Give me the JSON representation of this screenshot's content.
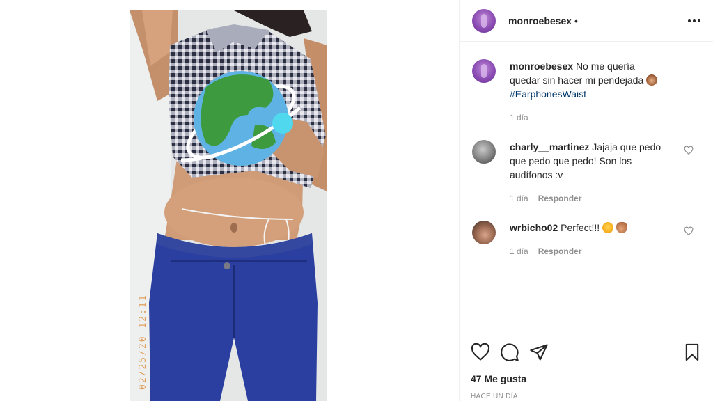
{
  "post": {
    "username": "monroebesex",
    "separator": "•",
    "photo_date_stamp": "02/25/20 12:11"
  },
  "caption": {
    "username": "monroebesex",
    "text": "No me quería quedar sin hacer mi pendejada",
    "emoji": "see-no-evil-monkey",
    "hashtag": "#EarphonesWaist",
    "time": "1 día"
  },
  "comments": [
    {
      "username": "charly__martinez",
      "text": "Jajaja que pedo que pedo que pedo! Son los audífonos :v",
      "time": "1 día",
      "reply_label": "Responder"
    },
    {
      "username": "wrbicho02",
      "text": "Perfect!!!",
      "emoji": [
        "star-struck-face",
        "ok-hand"
      ],
      "time": "1 día",
      "reply_label": "Responder"
    }
  ],
  "actions": {
    "likes": "47 Me gusta",
    "posted": "HACE UN DÍA",
    "icons": [
      "heart-icon",
      "comment-icon",
      "share-icon",
      "bookmark-icon"
    ]
  },
  "colors": {
    "text": "#262626",
    "muted": "#8e8e8e",
    "link": "#00376b",
    "border": "#efefef",
    "date_stamp": "#e0a05c"
  }
}
